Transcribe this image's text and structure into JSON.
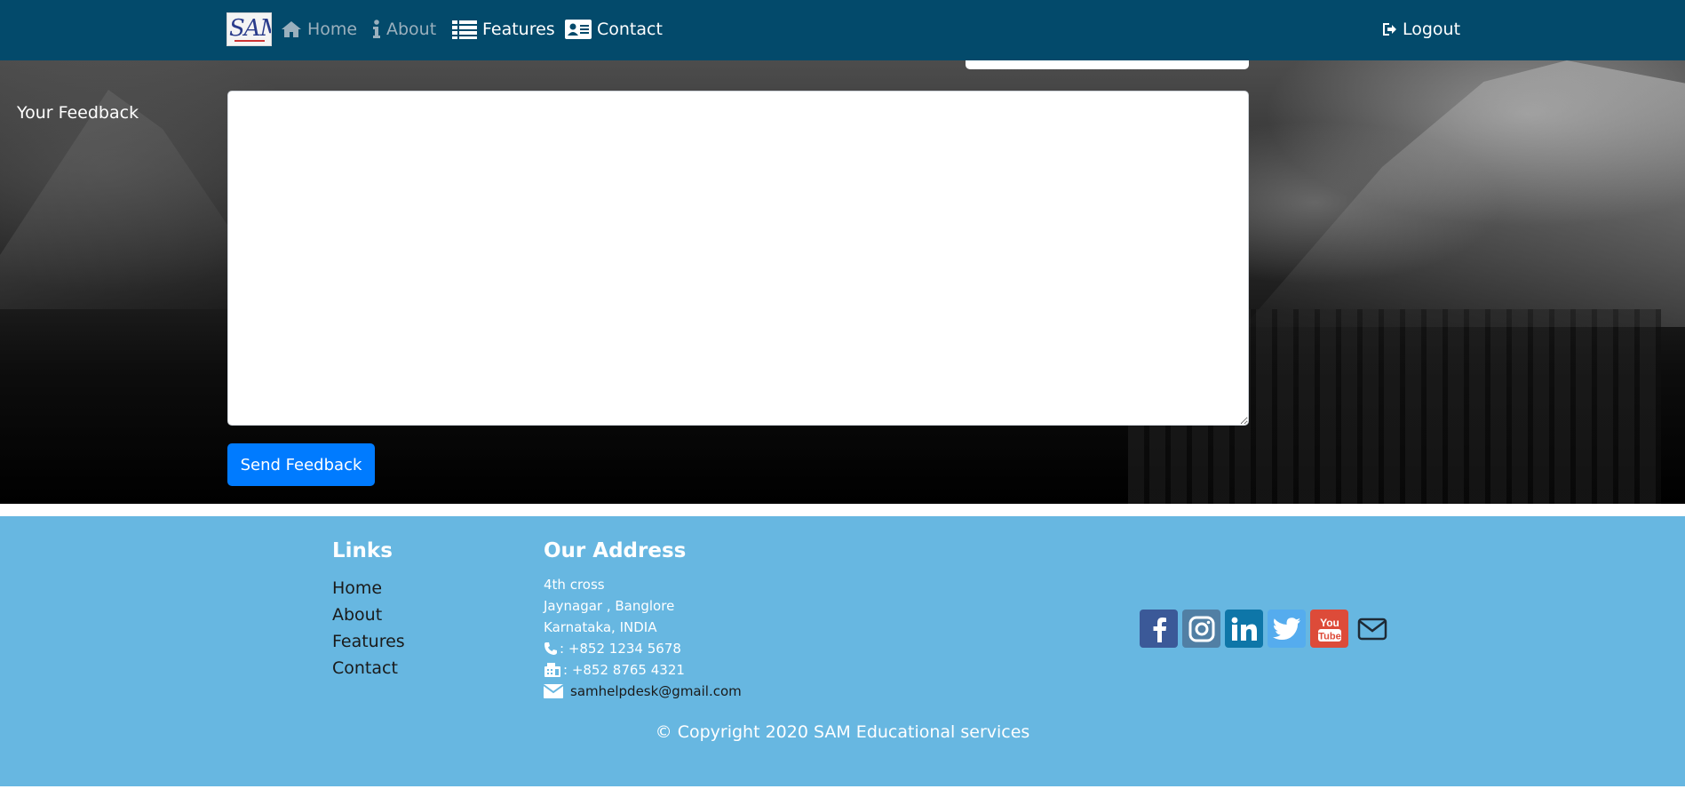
{
  "nav": {
    "logo_text": "SAM",
    "items": [
      {
        "label": "Home",
        "icon": "home-icon"
      },
      {
        "label": "About",
        "icon": "info-icon"
      },
      {
        "label": "Features",
        "icon": "list-icon"
      },
      {
        "label": "Contact",
        "icon": "contact-card-icon"
      }
    ],
    "logout_label": "Logout",
    "colors": {
      "bar": "#034a6b",
      "active": "#ffffff",
      "muted": "#9bb0bd"
    }
  },
  "form": {
    "feedback_label": "Your Feedback",
    "feedback_value": "",
    "send_label": "Send Feedback",
    "button_color": "#007bff"
  },
  "footer": {
    "background": "#67b7e1",
    "links_title": "Links",
    "links": [
      "Home",
      "About",
      "Features",
      "Contact"
    ],
    "address_title": "Our Address",
    "address_lines": [
      "4th cross",
      "Jaynagar , Banglore",
      "Karnataka, INDIA"
    ],
    "phone": ": +852 1234 5678",
    "fax": ": +852 8765 4321",
    "email": "samhelpdesk@gmail.com",
    "social": [
      {
        "name": "facebook-icon",
        "color": "#3b5998"
      },
      {
        "name": "instagram-icon",
        "color": "#517fa4"
      },
      {
        "name": "linkedin-icon",
        "color": "#0e76a8"
      },
      {
        "name": "twitter-icon",
        "color": "#55acee"
      },
      {
        "name": "youtube-icon",
        "color": "#dd4b39"
      },
      {
        "name": "mail-icon",
        "color": "transparent"
      }
    ],
    "copyright": "© Copyright 2020 SAM Educational services"
  }
}
